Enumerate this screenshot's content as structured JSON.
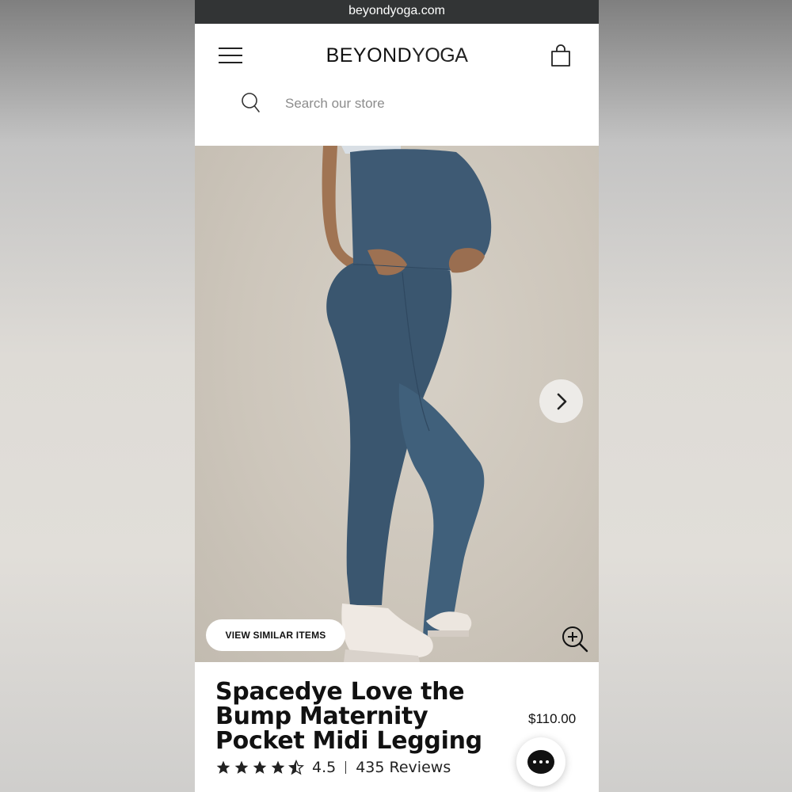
{
  "browser": {
    "url": "beyondyoga.com"
  },
  "header": {
    "logo_part1": "BEYOND",
    "logo_part2": "YOGA"
  },
  "search": {
    "placeholder": "Search our store"
  },
  "gallery": {
    "similar_label": "VIEW SIMILAR ITEMS"
  },
  "product": {
    "title": "Spacedye Love the Bump Maternity Pocket Midi Legging",
    "price": "$110.00",
    "rating": "4.5",
    "reviews": "435 Reviews"
  },
  "colors": {
    "legging": "#3e5a74",
    "url_bar": "#323435",
    "text": "#111111"
  },
  "icons": [
    "menu-icon",
    "bag-icon",
    "search-icon",
    "chevron-right-icon",
    "zoom-in-icon",
    "star-icon",
    "chat-icon"
  ]
}
